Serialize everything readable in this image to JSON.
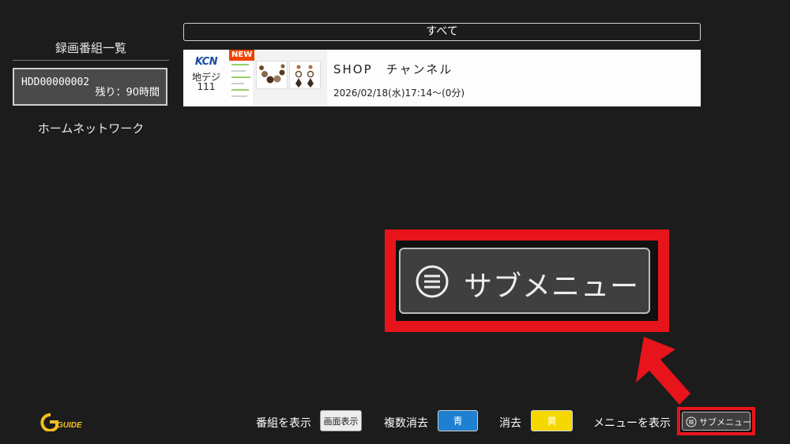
{
  "sidebar": {
    "title": "録画番組一覧",
    "drive": {
      "name": "HDD00000002",
      "remaining": "残り：90時間"
    },
    "home_network": "ホームネットワーク"
  },
  "filter": {
    "label": "すべて"
  },
  "recordings": [
    {
      "channel_brand": "KCN",
      "channel_type": "地デジ",
      "channel_number": "111",
      "badge": "NEW",
      "title": "SHOP　チャンネル",
      "datetime": "2026/02/18(水)17:14～(0分)"
    }
  ],
  "callout": {
    "label": "サブメニュー",
    "icon": "menu-lines-icon"
  },
  "footer": {
    "logo": "G GUIDE",
    "show_program_label": "番組を表示",
    "show_program_key": "画面表示",
    "multi_delete_label": "複数消去",
    "multi_delete_key": "青",
    "delete_label": "消去",
    "delete_key": "黄",
    "show_menu_label": "メニューを表示",
    "submenu_key": "サブメニュー"
  },
  "colors": {
    "background": "#1c1c1c",
    "highlight_red": "#e8141b",
    "blue_key": "#1f7fd0",
    "yellow_key": "#f5d800",
    "new_badge": "#ee4400"
  }
}
